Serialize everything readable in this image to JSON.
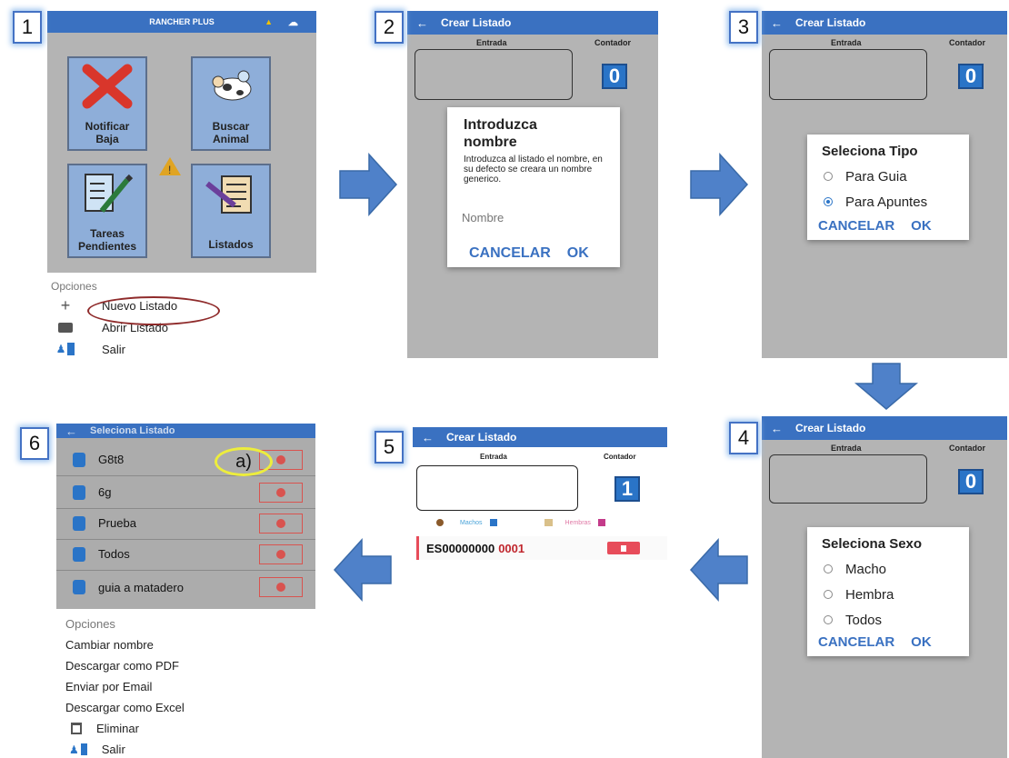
{
  "steps": [
    "1",
    "2",
    "3",
    "4",
    "5",
    "6"
  ],
  "panel1": {
    "app_title": "RANCHER PLUS",
    "tiles": [
      {
        "label": "Notificar Baja"
      },
      {
        "label": "Buscar Animal"
      },
      {
        "label": "Tareas Pendientes"
      },
      {
        "label": "Listados"
      }
    ],
    "options_title": "Opciones",
    "options": [
      {
        "label": "Nuevo Listado",
        "icon": "plus-icon"
      },
      {
        "label": "Abrir Listado",
        "icon": "folder-icon"
      },
      {
        "label": "Salir",
        "icon": "exit-icon"
      }
    ]
  },
  "panel2": {
    "title": "Crear Listado",
    "entrada": "Entrada",
    "contador": "Contador",
    "counter": "0",
    "dialog_title": "Introduzca nombre",
    "dialog_text": "Introduzca al listado el nombre, en su defecto se creara un nombre generico.",
    "input_placeholder": "Nombre",
    "cancel": "CANCELAR",
    "ok": "OK"
  },
  "panel3": {
    "title": "Crear Listado",
    "entrada": "Entrada",
    "contador": "Contador",
    "counter": "0",
    "dialog_title": "Seleciona Tipo",
    "options": [
      {
        "label": "Para Guia",
        "selected": false
      },
      {
        "label": "Para Apuntes",
        "selected": true
      }
    ],
    "cancel": "CANCELAR",
    "ok": "OK"
  },
  "panel4": {
    "title": "Crear Listado",
    "entrada": "Entrada",
    "contador": "Contador",
    "counter": "0",
    "dialog_title": "Seleciona Sexo",
    "options": [
      {
        "label": "Macho"
      },
      {
        "label": "Hembra"
      },
      {
        "label": "Todos"
      }
    ],
    "cancel": "CANCELAR",
    "ok": "OK"
  },
  "panel5": {
    "title": "Crear Listado",
    "entrada": "Entrada",
    "contador": "Contador",
    "counter": "1",
    "machos": "Machos",
    "hembras": "Hembras",
    "entry_prefix": "ES00000000",
    "entry_suffix": "0001"
  },
  "panel6": {
    "title": "Seleciona Listado",
    "annotation": "a)",
    "lists": [
      "G8t8",
      "6g",
      "Prueba",
      "Todos",
      "guia a matadero"
    ],
    "options_title": "Opciones",
    "options": [
      "Cambiar nombre",
      "Descargar como PDF",
      "Enviar por Email",
      "Descargar como Excel",
      "Eliminar",
      "Salir"
    ]
  },
  "colors": {
    "accent": "#3a71c1",
    "arrow": "#4f81c9",
    "danger": "#d9534f"
  }
}
